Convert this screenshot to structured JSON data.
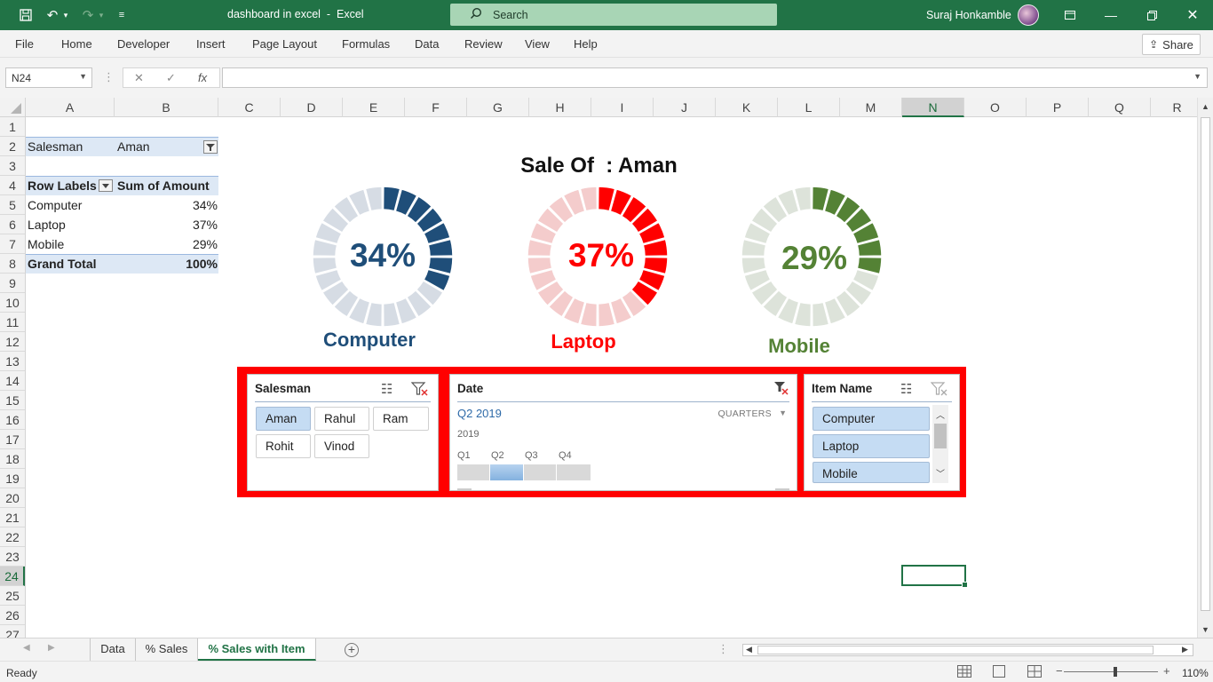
{
  "window": {
    "title": "dashboard in excel  -  Excel",
    "search_placeholder": "Search",
    "user": "Suraj Honkamble"
  },
  "menu": [
    "File",
    "Home",
    "Developer",
    "Insert",
    "Page Layout",
    "Formulas",
    "Data",
    "Review",
    "View",
    "Help"
  ],
  "share_label": "Share",
  "formula_bar": {
    "name_box": "N24",
    "formula": ""
  },
  "columns": [
    "A",
    "B",
    "C",
    "D",
    "E",
    "F",
    "G",
    "H",
    "I",
    "J",
    "K",
    "L",
    "M",
    "N",
    "O",
    "P",
    "Q",
    "R"
  ],
  "active_column": "N",
  "rows": [
    "1",
    "2",
    "3",
    "4",
    "5",
    "6",
    "7",
    "8",
    "9",
    "10",
    "11",
    "12",
    "13",
    "14",
    "15",
    "16",
    "17",
    "18",
    "19",
    "20",
    "21",
    "22",
    "23",
    "24",
    "25",
    "26",
    "27"
  ],
  "active_row": "24",
  "pivot": {
    "filter_label": "Salesman",
    "filter_value": "Aman",
    "header_rows": "Row Labels",
    "header_values": "Sum of Amount",
    "items": [
      {
        "label": "Computer",
        "value": "34%"
      },
      {
        "label": "Laptop",
        "value": "37%"
      },
      {
        "label": "Mobile",
        "value": "29%"
      }
    ],
    "total_label": "Grand Total",
    "total_value": "100%"
  },
  "dashboard": {
    "title": "Sale Of  : Aman",
    "donuts": [
      {
        "label": "Computer",
        "pct_text": "34%",
        "value": 0.34,
        "color": "#1f4e79",
        "track": "#d6dce4"
      },
      {
        "label": "Laptop",
        "pct_text": "37%",
        "value": 0.37,
        "color": "#ff0000",
        "track": "#f4cccc"
      },
      {
        "label": "Mobile",
        "pct_text": "29%",
        "value": 0.29,
        "color": "#548235",
        "track": "#dde3da"
      }
    ]
  },
  "slicers": {
    "salesman": {
      "title": "Salesman",
      "items": [
        "Aman",
        "Rahul",
        "Ram",
        "Rohit",
        "Vinod"
      ],
      "selected": "Aman"
    },
    "date": {
      "title": "Date",
      "period": "Q2 2019",
      "level": "QUARTERS",
      "year": "2019",
      "quarters": [
        "Q1",
        "Q2",
        "Q3",
        "Q4"
      ],
      "selected_quarter": "Q2"
    },
    "item": {
      "title": "Item Name",
      "items": [
        "Computer",
        "Laptop",
        "Mobile"
      ]
    }
  },
  "sheets": [
    "Data",
    "% Sales",
    "% Sales with Item"
  ],
  "active_sheet": "% Sales with Item",
  "status": {
    "ready": "Ready",
    "zoom": "110%"
  },
  "colors": {
    "excel_green": "#217346",
    "frame_red": "#ff0000",
    "selected_blue": "#c5dcf3"
  }
}
